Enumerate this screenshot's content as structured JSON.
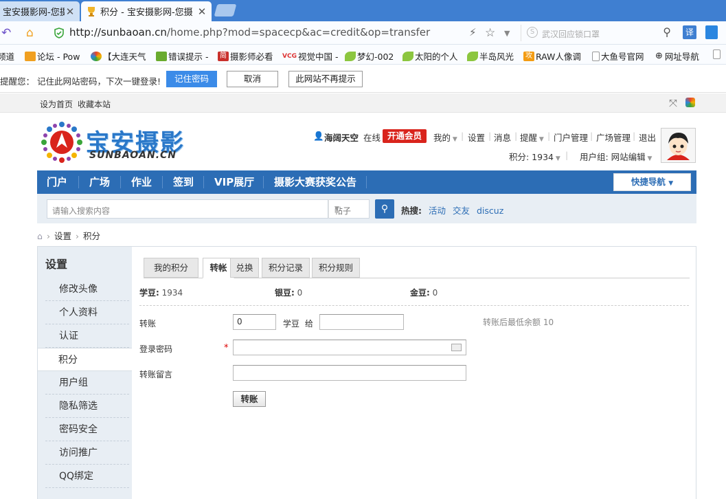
{
  "browser": {
    "tabs": [
      {
        "title": "宝安摄影网-您摄影"
      },
      {
        "title": "积分 - 宝安摄影网-您摄"
      }
    ],
    "url_host": "http://sunbaoan.cn",
    "url_path": "/home.php?mod=spacecp&ac=credit&op=transfer",
    "search_placeholder": "武汉回应锁口罩",
    "bookmarks": [
      {
        "label": "频道",
        "color": "#ffffff"
      },
      {
        "label": "论坛 - Pow",
        "color": "#f0a020"
      },
      {
        "label": "【大连天气",
        "color": "#e8452c"
      },
      {
        "label": "错误提示 -",
        "color": "#6aab2e"
      },
      {
        "label": "摄影师必看",
        "color": "#c9302c"
      },
      {
        "label": "视觉中国 -",
        "color": "#d33"
      },
      {
        "label": "梦幻-002",
        "color": "#8cc63f"
      },
      {
        "label": "太阳的个人",
        "color": "#8cc63f"
      },
      {
        "label": "半岛风光",
        "color": "#8cc63f"
      },
      {
        "label": "RAW人像调",
        "color": "#f39c12"
      },
      {
        "label": "大鱼号官网",
        "color": "#ffffff"
      },
      {
        "label": "网址导航",
        "color": "#ffffff"
      }
    ],
    "pwd_prompt": {
      "message": "提醒您：  记住此网站密码，下次一键登录!",
      "remember": "记住密码",
      "cancel": "取消",
      "never": "此网站不再提示"
    }
  },
  "site": {
    "top_links": {
      "home": "设为首页",
      "fav": "收藏本站"
    },
    "logo_cn": "宝安摄影",
    "logo_en": "SUNBAOAN.CN",
    "user": {
      "name": "海阔天空",
      "status": "在线",
      "vip": "开通会员",
      "links": [
        "我的",
        "设置",
        "消息",
        "提醒",
        "门户管理",
        "广场管理",
        "退出"
      ],
      "credits": "积分: 1934",
      "group": "用户组: 网站编辑"
    },
    "nav": [
      "门户",
      "广场",
      "作业",
      "签到",
      "VIP展厅",
      "摄影大赛获奖公告"
    ],
    "quick_nav": "快捷导航",
    "search": {
      "placeholder": "请输入搜索内容",
      "type": "帖子",
      "hot_label": "热搜:",
      "hot": [
        "活动",
        "交友",
        "discuz"
      ]
    },
    "breadcrumb": [
      "设置",
      "积分"
    ]
  },
  "settings": {
    "title": "设置",
    "menu": [
      "修改头像",
      "个人资料",
      "认证",
      "积分",
      "用户组",
      "隐私筛选",
      "密码安全",
      "访问推广",
      "QQ绑定"
    ],
    "active_index": 3,
    "tabs": [
      "我的积分",
      "转帐",
      "兑换",
      "积分记录",
      "积分规则"
    ],
    "active_tab": 1,
    "coins": [
      {
        "label": "学豆:",
        "value": "1934"
      },
      {
        "label": "银豆:",
        "value": "0"
      },
      {
        "label": "金豆:",
        "value": "0"
      }
    ],
    "form": {
      "transfer_label": "转账",
      "amount_value": "0",
      "unit_label": "学豆",
      "give_label": "给",
      "min_hint": "转账后最低余额 10",
      "password_label": "登录密码",
      "required_mark": "*",
      "note_label": "转账留言",
      "submit": "转账"
    }
  }
}
